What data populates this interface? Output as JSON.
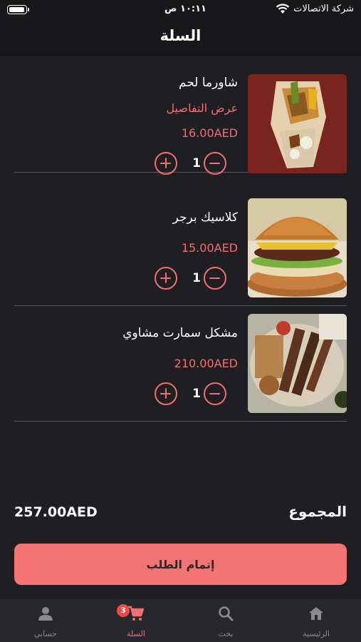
{
  "status_bar": {
    "carrier": "شركة الاتصالات",
    "time": "١٠:١١ ص"
  },
  "header": {
    "title": "السلة"
  },
  "cart_items": [
    {
      "name": "شاورما لحم",
      "details_link": "عرض التفاصيل",
      "price": "16.00AED",
      "quantity": "1",
      "image": "shawarma-photo"
    },
    {
      "name": "كلاسيك برجر",
      "price": "15.00AED",
      "quantity": "1",
      "image": "burger-photo"
    },
    {
      "name": "مشكل سمارت مشاوي",
      "price": "210.00AED",
      "quantity": "1",
      "image": "mixed-grill-photo"
    }
  ],
  "summary": {
    "total_label": "المجموع",
    "total_value": "257.00AED"
  },
  "checkout": {
    "label": "إتمام الطلب"
  },
  "tab_bar": {
    "items": [
      {
        "label": "الرئيسية",
        "icon": "home-icon"
      },
      {
        "label": "بحث",
        "icon": "search-icon"
      },
      {
        "label": "السلة",
        "icon": "cart-icon",
        "badge": "3",
        "active": true
      },
      {
        "label": "حسابي",
        "icon": "person-icon"
      }
    ]
  },
  "colors": {
    "accent": "#f07070",
    "button": "#f47373",
    "background": "#1f1f23",
    "badge": "#f04848"
  }
}
